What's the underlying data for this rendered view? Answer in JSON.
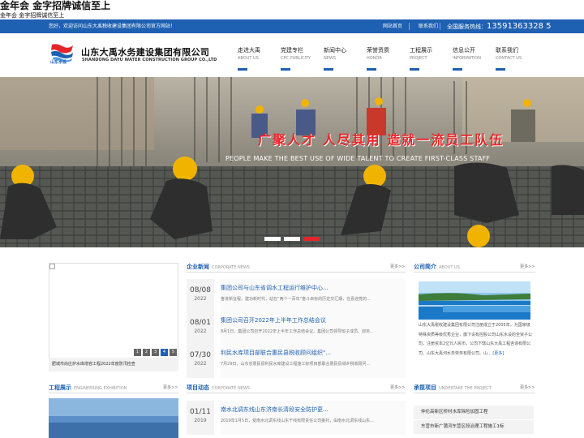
{
  "site": {
    "title": "金年会 金字招牌诚信至上",
    "subtitle": "金年会 金字招牌诚信至上"
  },
  "topbar": {
    "welcome": "您好，欢迎访问山东大禹税收建设集团有限公司官方网站！",
    "links": [
      "网站首页",
      "联系我们"
    ],
    "hotline_label": "全国服务热线：",
    "hotline_number": "13591363328 5"
  },
  "header": {
    "company_cn": "山东大禹水务建设集团有限公司",
    "company_en": "SHANDONG DAYU WATER CONSTRUCTION GROUP CO.,LTD",
    "logo_text": "山东水设",
    "nav": [
      {
        "cn": "走进大禹",
        "en": "ABOUT US"
      },
      {
        "cn": "党建专栏",
        "en": "CPC PUBLICITY"
      },
      {
        "cn": "新闻中心",
        "en": "NEWS"
      },
      {
        "cn": "荣誉资质",
        "en": "HONOR"
      },
      {
        "cn": "工程展示",
        "en": "PROJECT"
      },
      {
        "cn": "信息公开",
        "en": "INFORMATION"
      },
      {
        "cn": "联系我们",
        "en": "CONTACT US"
      }
    ]
  },
  "banner": {
    "slogan": "广聚人才 人尽其用 造就一流员工队伍",
    "slogan_en": "PEOPLE MAKE THE BEST USE OF WIDE TALENT TO CREATE FIRST-CLASS STAFF"
  },
  "photo_panel": {
    "pages": [
      "1",
      "2",
      "3",
      "4",
      "5"
    ],
    "active_page": "4",
    "caption": "肥城市尚庄炉水库增容工程2022年度防汛检查"
  },
  "news": {
    "title": "企业新闻",
    "title_en": "CORPORATE NEWS",
    "more": "更多>>",
    "items": [
      {
        "md": "08/08",
        "year": "2022",
        "title": "集团公司与山东省调水工程运行维护中心...",
        "desc": "奋进新征程，建功新时代，站在“两个一百年”奋斗目标的历史交汇期，在喜迎党的..."
      },
      {
        "md": "08/01",
        "year": "2022",
        "title": "集团公司召开2022年上半年工作总结会议",
        "desc": "8月1日，集团公司召开2022年上半年工作总结会议。集团公司领导班子成员、财务..."
      },
      {
        "md": "07/30",
        "year": "2022",
        "title": "利民水库项目部联合惠民县税收顾问组织\"...",
        "desc": "7月29日，山东省惠民县利民水库建设工程施工标项目部联合惠民县城乡税收顾问..."
      }
    ]
  },
  "about": {
    "title": "公司简介",
    "title_en": "ABOUT US",
    "more": "更多>>",
    "text": "山东大禹税收建设集团有限公司注册成立于2005年，为国家级特殊资质等级优秀企业，旗下设有控股公司山东水设的全资子公司，注册资本2亿元人民币，公司下辖山东大禹工程咨询有限公司、山东大禹河水务劳务有限公司、山...",
    "more_link": "[更多]"
  },
  "projects": {
    "title": "工程展示",
    "title_en": "ENGINEERING EXHIBITION",
    "more": "更多>>"
  },
  "project_news": {
    "title": "项目动态",
    "title_en": "CORPORATE NEWS",
    "more": "更多>>",
    "item": {
      "md": "01/11",
      "year": "2019",
      "title": "南水北调东线山东济南长清段安全防护更...",
      "desc": "2019年1月5日，受南水北调东线山东干线有限责任公司委托，由南水北调东线山东..."
    }
  },
  "undertake": {
    "title": "承揽项目",
    "title_en": "UNDERTAKE THE PROJECT",
    "more": "更多>>",
    "items": [
      "仲伦高新区桥村水库除险加固工程",
      "东营市新广蒲河东营区段治理工程施工1标"
    ]
  }
}
